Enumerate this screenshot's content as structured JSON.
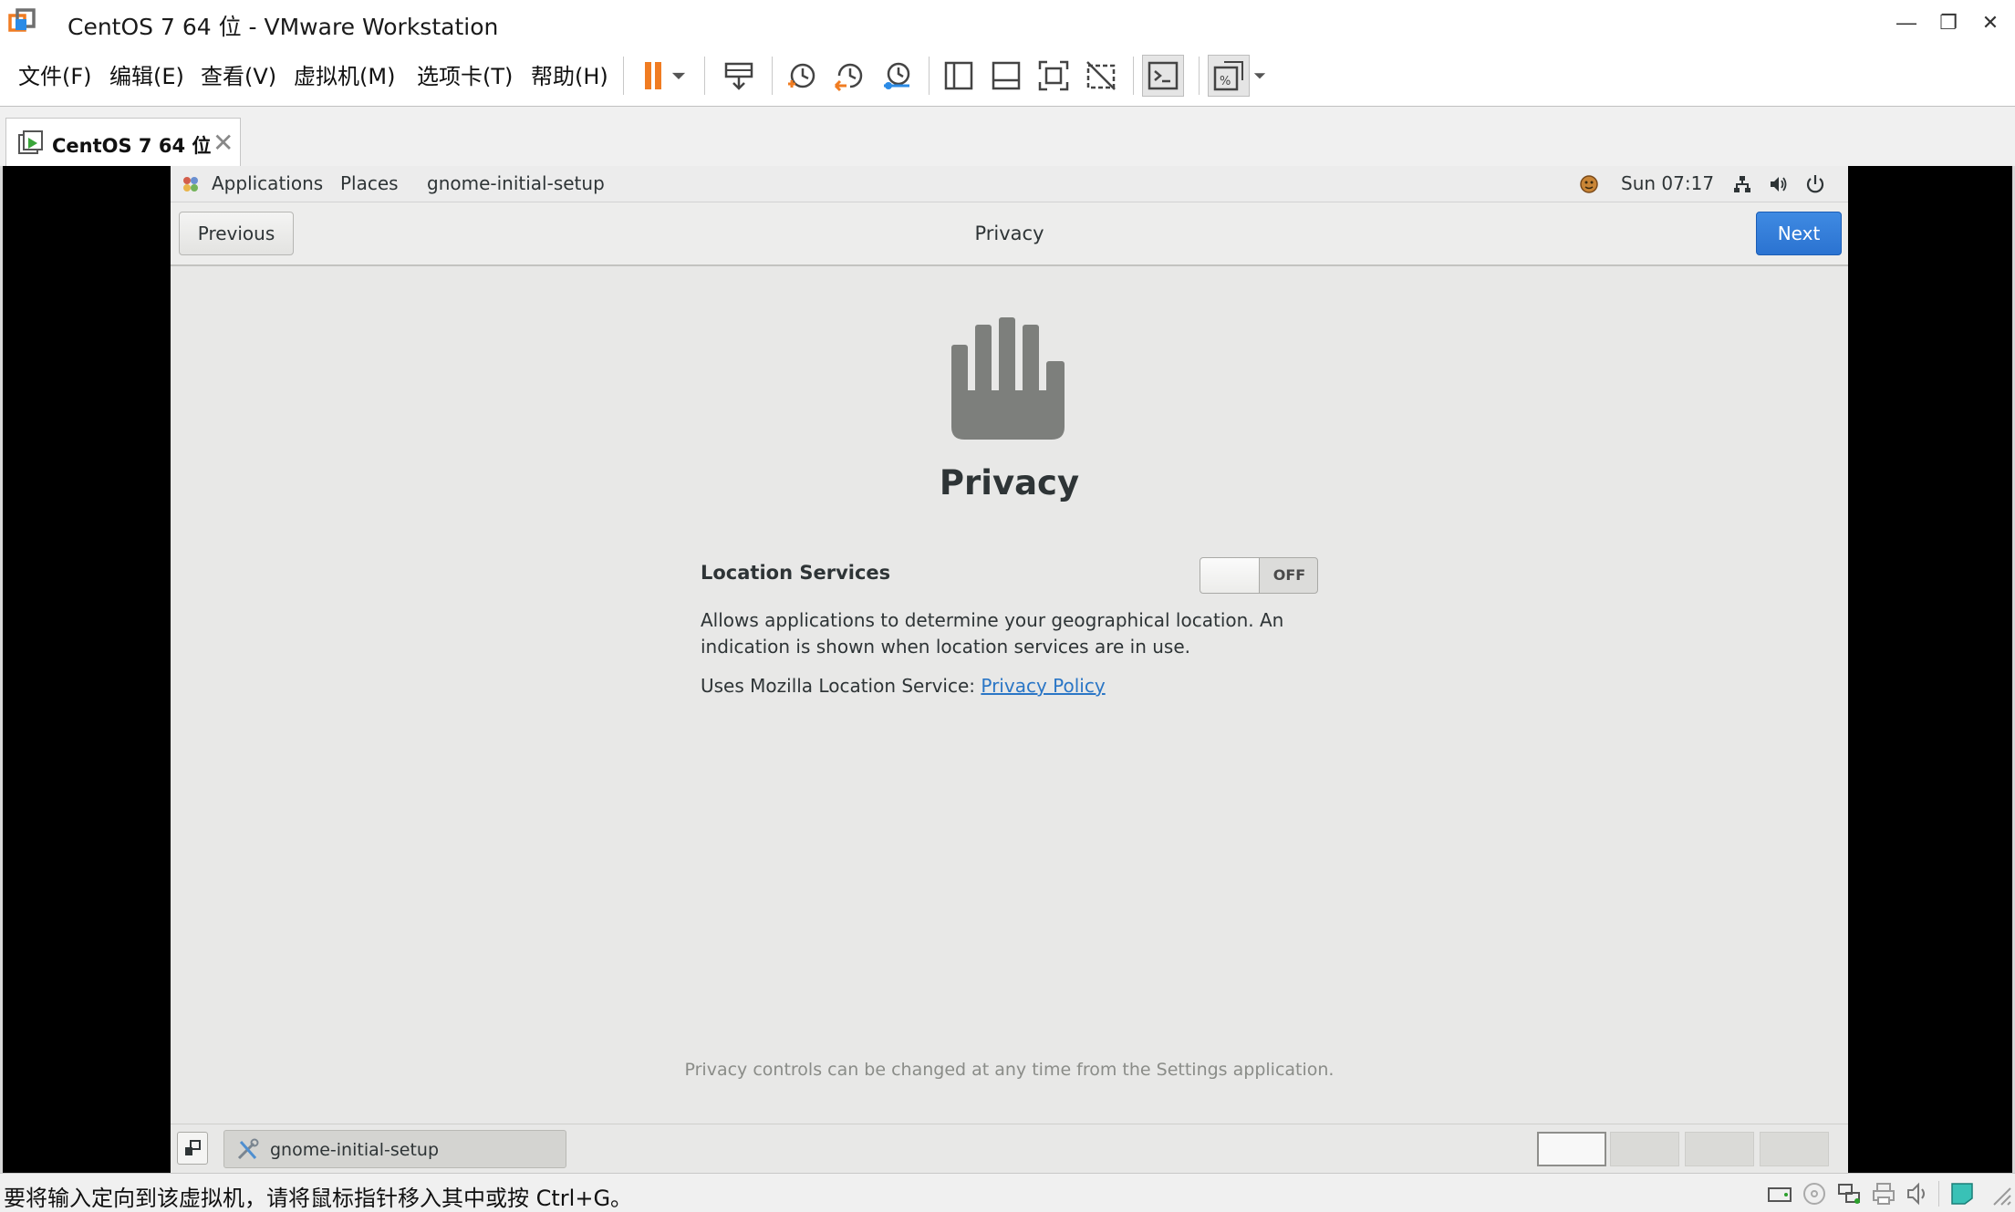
{
  "window": {
    "title": "CentOS 7 64 位 - VMware Workstation",
    "controls": {
      "minimize": "—",
      "restore": "❐",
      "close": "✕"
    }
  },
  "menubar": {
    "items": [
      "文件(F)",
      "编辑(E)",
      "查看(V)",
      "虚拟机(M)",
      "选项卡(T)",
      "帮助(H)"
    ],
    "toolbar_icons": [
      "pause-icon",
      "dropdown-icon",
      "send-ctrl-alt-del-icon",
      "snapshot-icon",
      "revert-snapshot-icon",
      "snapshot-manager-icon",
      "library-view-icon",
      "thumbnail-bar-icon",
      "full-screen-icon",
      "unity-icon",
      "console-view-icon",
      "stretch-guest-icon"
    ],
    "accent": "#f07c22"
  },
  "tab": {
    "label": "CentOS 7 64 位",
    "close": "✕"
  },
  "guest": {
    "topbar": {
      "applications": "Applications",
      "places": "Places",
      "active_app": "gnome-initial-setup",
      "clock": "Sun 07:17"
    },
    "header": {
      "previous": "Previous",
      "title": "Privacy",
      "next": "Next",
      "next_color": "#3584e4"
    },
    "page": {
      "heading": "Privacy",
      "location_label": "Location Services",
      "toggle_state": "OFF",
      "description_line1": "Allows applications to determine your geographical location. An",
      "description_line2": "indication is shown when location services are in use.",
      "uses_prefix": "Uses Mozilla Location Service: ",
      "policy_link": "Privacy Policy",
      "footer_note": "Privacy controls can be changed at any time from the Settings application."
    },
    "taskbar": {
      "task_label": "gnome-initial-setup",
      "workspace_count": 4,
      "active_workspace": 1
    }
  },
  "statusbar": {
    "message": "要将输入定向到该虚拟机，请将鼠标指针移入其中或按 Ctrl+G。",
    "icons": [
      "hard-disk-icon",
      "cd-dvd-icon",
      "network-adapter-icon",
      "printer-icon",
      "sound-card-icon",
      "message-log-icon",
      "resize-grip-icon"
    ]
  }
}
